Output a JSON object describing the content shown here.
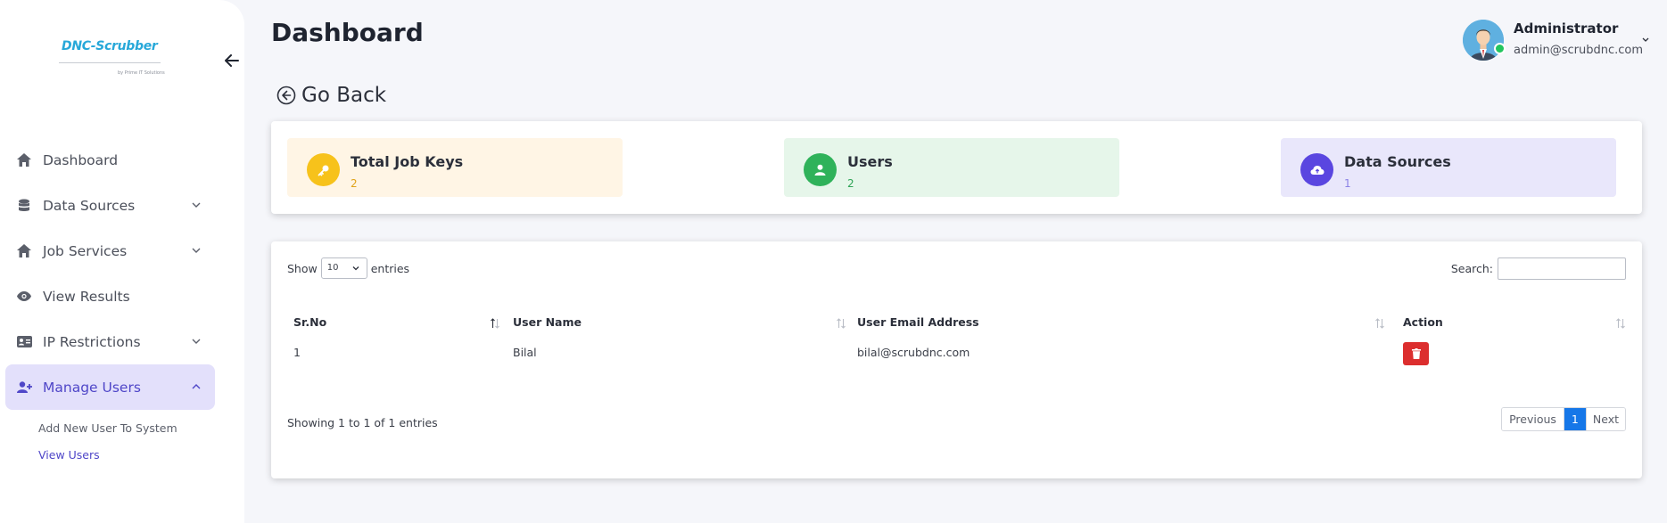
{
  "sidebar": {
    "logo_text": "DNC-Scrubber",
    "logo_sub": "by Prime IT Solutions",
    "items": [
      {
        "label": "Dashboard"
      },
      {
        "label": "Data Sources"
      },
      {
        "label": "Job Services"
      },
      {
        "label": "View Results"
      },
      {
        "label": "IP Restrictions"
      },
      {
        "label": "Manage Users"
      }
    ],
    "sub_items": [
      {
        "label": "Add New User To System"
      },
      {
        "label": "View Users"
      }
    ]
  },
  "header": {
    "title": "Dashboard",
    "user_name": "Administrator",
    "user_email": "admin@scrubdnc.com"
  },
  "go_back_label": "Go Back",
  "stats": [
    {
      "title": "Total Job Keys",
      "value": "2",
      "bg": "#fff5e5",
      "icon_color": "#f7c21b",
      "value_color": "#e0a31a"
    },
    {
      "title": "Users",
      "value": "2",
      "bg": "#e6f6ea",
      "icon_color": "#2fb25a",
      "value_color": "#2fa457"
    },
    {
      "title": "Data Sources",
      "value": "1",
      "bg": "#e9e7fb",
      "icon_color": "#5a46e0",
      "value_color": "#8b82e6"
    }
  ],
  "table": {
    "show_label": "Show",
    "entries_label": "entries",
    "page_size": "10",
    "search_label": "Search:",
    "search_value": "",
    "columns": [
      "Sr.No",
      "User Name",
      "User Email Address",
      "Action"
    ],
    "rows": [
      {
        "sr": "1",
        "name": "Bilal",
        "email": "bilal@scrubdnc.com"
      }
    ],
    "info": "Showing 1 to 1 of 1 entries",
    "pager": {
      "previous": "Previous",
      "page": "1",
      "next": "Next"
    }
  },
  "colors": {
    "accent": "#4f46c8",
    "delete": "#dc2e2e",
    "page_active": "#1677e8"
  }
}
